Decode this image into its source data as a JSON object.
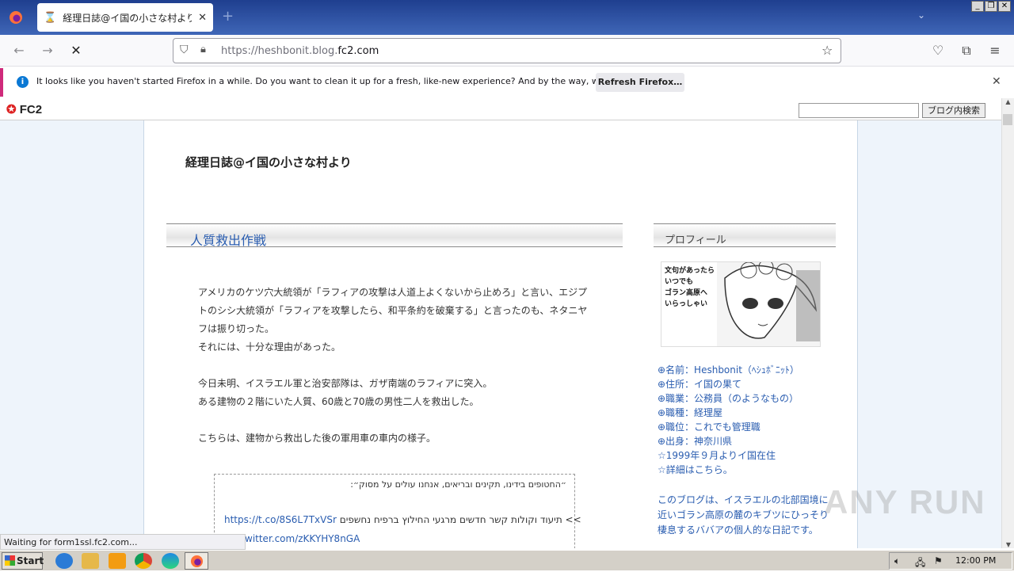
{
  "browser": {
    "tab_title": "経理日誌@イ国の小さな村より",
    "url_prefix": "https://heshbonit.blog.",
    "url_domain": "fc2.com",
    "notification": {
      "message": "It looks like you haven't started Firefox in a while. Do you want to clean it up for a fresh, like-new experience? And by the way, welcome back!",
      "button": "Refresh Firefox…"
    },
    "status": "Waiting for form1ssl.fc2.com..."
  },
  "fc2": {
    "logo": "FC2",
    "search_button": "ブログ内検索"
  },
  "blog": {
    "title": "経理日誌@イ国の小さな村より",
    "entry": {
      "title": "人質救出作戦",
      "p1": "アメリカのケツ穴大統領が「ラフィアの攻撃は人道上よくないから止めろ」と言い、エジプトのシシ大統領が「ラフィアを攻撃したら、和平条約を破棄する」と言ったのも、ネタニヤフは振り切った。",
      "p2": "それには、十分な理由があった。",
      "p3": "今日未明、イスラエル軍と治安部隊は、ガザ南端のラフィアに突入。",
      "p4": "ある建物の２階にいた人質、60歳と70歳の男性二人を救出した。",
      "p5": "こちらは、建物から救出した後の軍用車の車内の様子。",
      "quote_line1": "״החטופים בידינו, תקינים ובריאים, אנחנו עולים על מסוק״:",
      "quote_link": "https://t.co/8S6L7TxVSr",
      "quote_line2": "תיעוד וקולות קשר חדשים מרגעי החילוץ ברפיח נחשפים <<",
      "quote_link2": "witter.com/zKKYHY8nGA"
    },
    "profile": {
      "title": "プロフィール",
      "image_caption": "文句があったら\nいつでも\nゴラン高原へ\nいらっしゃい",
      "items": [
        "⊕名前：Heshbonit（ﾍｼｭﾎﾞﾆｯﾄ）",
        "⊕住所：イ国の果て",
        "⊕職業：公務員（のようなもの）",
        "⊕職種：経理屋",
        "⊕職位：これでも管理職",
        "⊕出身：神奈川県",
        "☆1999年９月よりイ国在住",
        "☆詳細はこちら。"
      ],
      "description": "このブログは、イスラエルの北部国境に近いゴラン高原の麓のキブツにひっそり棲息するババアの個人的な日記です。"
    }
  },
  "taskbar": {
    "start": "Start",
    "clock": "12:00 PM"
  },
  "watermark": "ANY RUN"
}
